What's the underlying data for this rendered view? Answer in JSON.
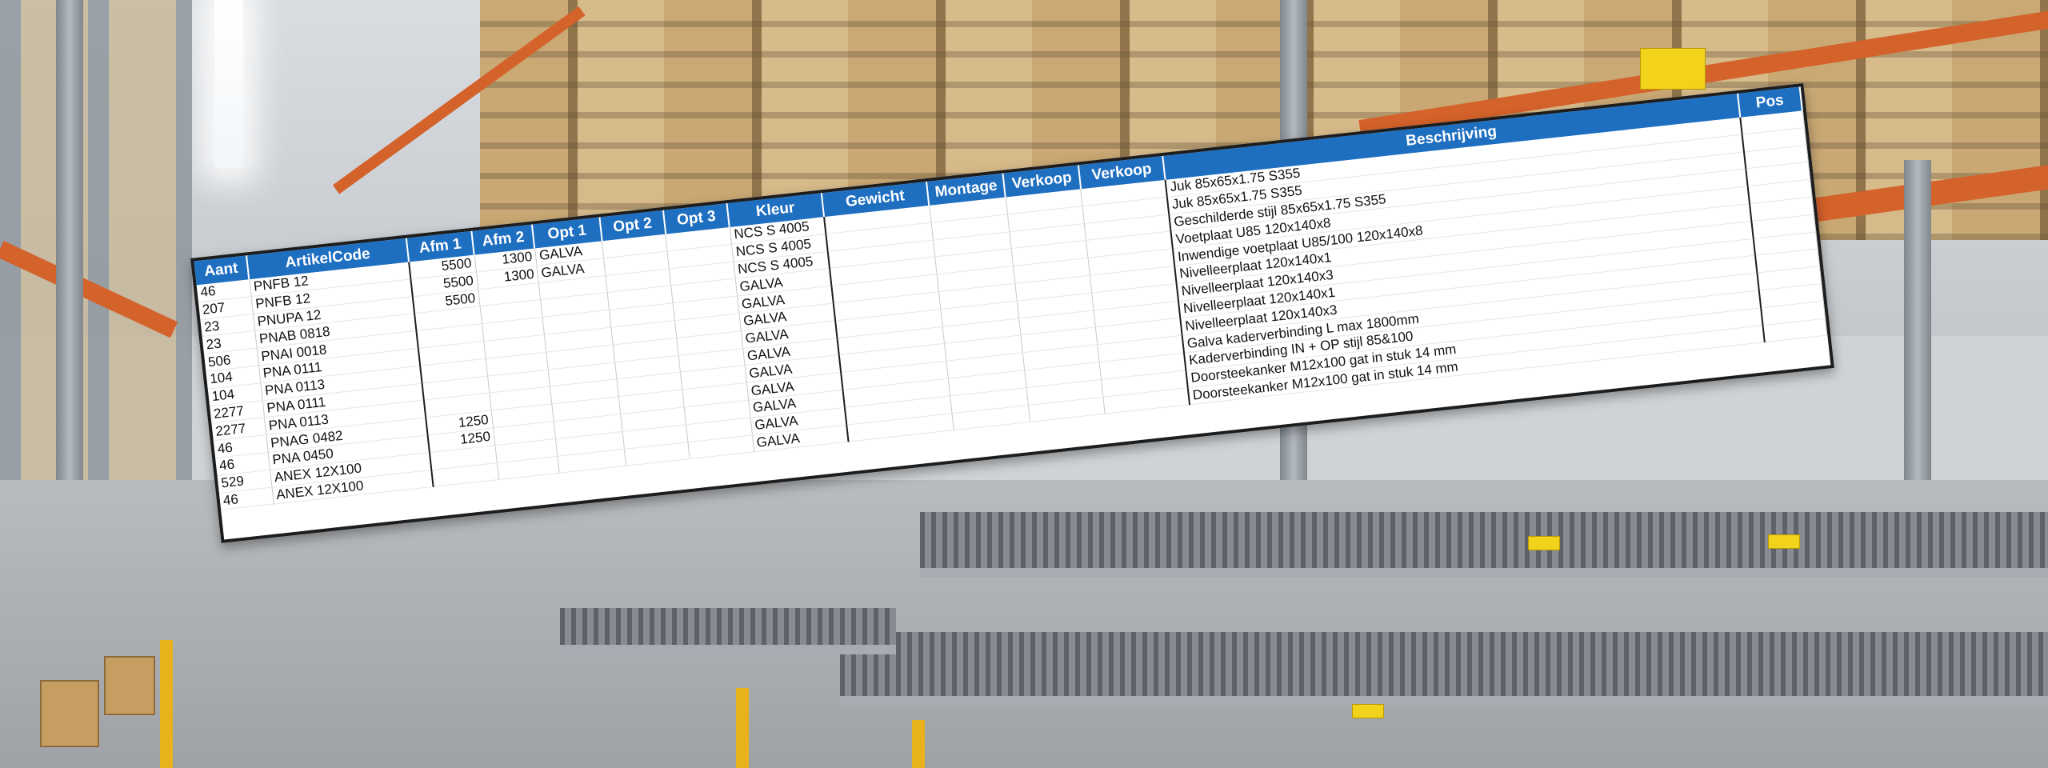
{
  "columns": {
    "aant": "Aant",
    "artikelcode": "ArtikelCode",
    "afm1": "Afm 1",
    "afm2": "Afm 2",
    "opt1": "Opt 1",
    "opt2": "Opt 2",
    "opt3": "Opt 3",
    "kleur": "Kleur",
    "gewicht": "Gewicht",
    "montage": "Montage",
    "verkoop1": "Verkoop",
    "verkoop2": "Verkoop",
    "beschrijving": "Beschrijving",
    "pos": "Pos"
  },
  "rows": [
    {
      "aant": "46",
      "code": "PNFB 12",
      "afm1": "5500",
      "afm2": "1300",
      "opt1": "GALVA",
      "kleur": "NCS S 4005",
      "beschrijving": "Juk 85x65x1.75 S355"
    },
    {
      "aant": "207",
      "code": "PNFB 12",
      "afm1": "5500",
      "afm2": "1300",
      "opt1": "GALVA",
      "kleur": "NCS S 4005",
      "beschrijving": "Juk 85x65x1.75 S355"
    },
    {
      "aant": "23",
      "code": "PNUPA 12",
      "afm1": "5500",
      "afm2": "",
      "opt1": "",
      "kleur": "NCS S 4005",
      "beschrijving": "Geschilderde stijl 85x65x1.75 S355"
    },
    {
      "aant": "23",
      "code": "PNAB 0818",
      "afm1": "",
      "afm2": "",
      "opt1": "",
      "kleur": "GALVA",
      "beschrijving": "Voetplaat U85 120x140x8"
    },
    {
      "aant": "506",
      "code": "PNAI 0018",
      "afm1": "",
      "afm2": "",
      "opt1": "",
      "kleur": "GALVA",
      "beschrijving": "Inwendige voetplaat U85/100 120x140x8"
    },
    {
      "aant": "104",
      "code": "PNA 0111",
      "afm1": "",
      "afm2": "",
      "opt1": "",
      "kleur": "GALVA",
      "beschrijving": "Nivelleerplaat 120x140x1"
    },
    {
      "aant": "104",
      "code": "PNA 0113",
      "afm1": "",
      "afm2": "",
      "opt1": "",
      "kleur": "GALVA",
      "beschrijving": "Nivelleerplaat 120x140x3"
    },
    {
      "aant": "2277",
      "code": "PNA 0111",
      "afm1": "",
      "afm2": "",
      "opt1": "",
      "kleur": "GALVA",
      "beschrijving": "Nivelleerplaat 120x140x1"
    },
    {
      "aant": "2277",
      "code": "PNA 0113",
      "afm1": "",
      "afm2": "",
      "opt1": "",
      "kleur": "GALVA",
      "beschrijving": "Nivelleerplaat 120x140x3"
    },
    {
      "aant": "46",
      "code": "PNAG 0482",
      "afm1": "1250",
      "afm2": "",
      "opt1": "",
      "kleur": "GALVA",
      "beschrijving": "Galva kaderverbinding L max 1800mm"
    },
    {
      "aant": "46",
      "code": "PNA 0450",
      "afm1": "1250",
      "afm2": "",
      "opt1": "",
      "kleur": "GALVA",
      "beschrijving": "Kaderverbinding IN + OP stijl 85&100"
    },
    {
      "aant": "529",
      "code": "ANEX 12X100",
      "afm1": "",
      "afm2": "",
      "opt1": "",
      "kleur": "GALVA",
      "beschrijving": "Doorsteekanker M12x100 gat in stuk 14 mm"
    },
    {
      "aant": "46",
      "code": "ANEX 12X100",
      "afm1": "",
      "afm2": "",
      "opt1": "",
      "kleur": "GALVA",
      "beschrijving": "Doorsteekanker M12x100 gat in stuk 14 mm"
    }
  ],
  "colors": {
    "header_blue": "#1f6fc1",
    "rack_orange": "#d4622b",
    "label_yellow": "#f2d21b"
  }
}
